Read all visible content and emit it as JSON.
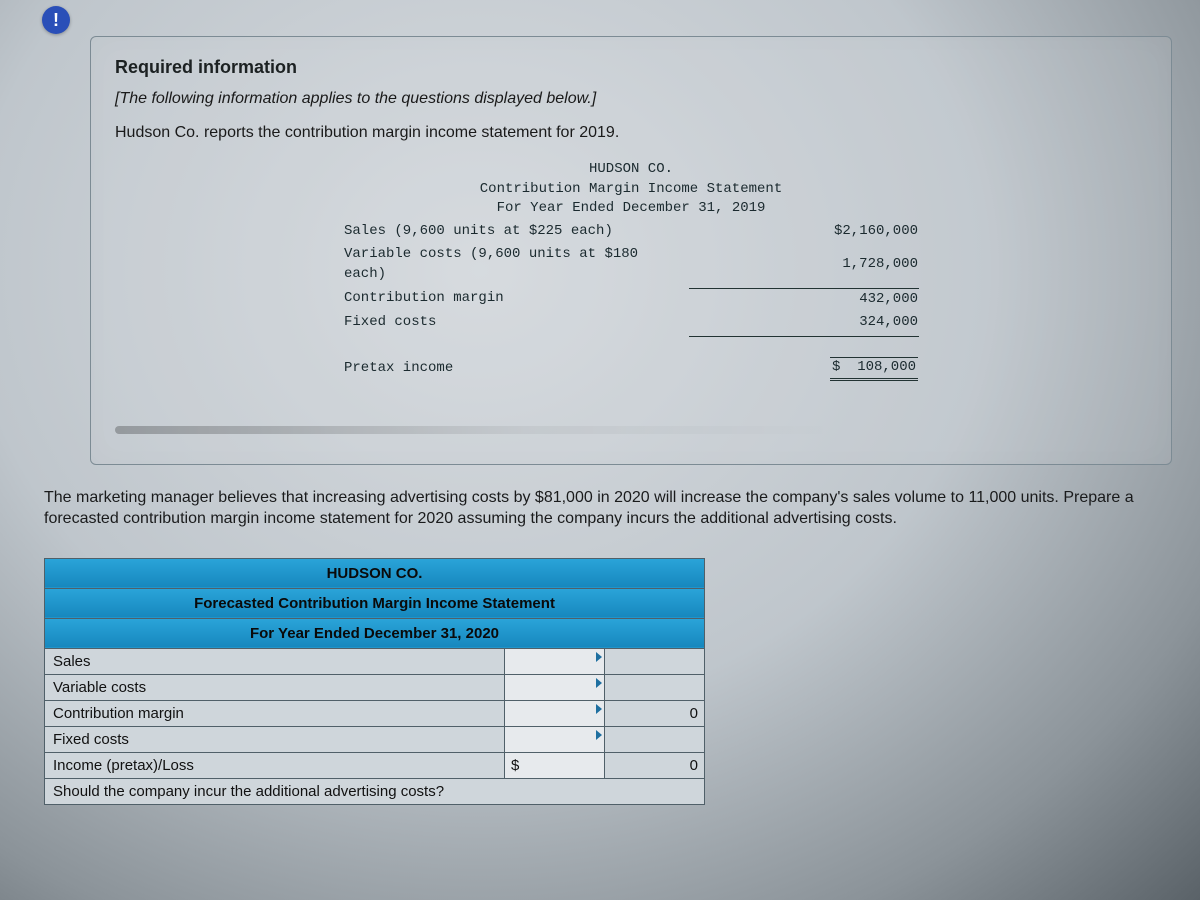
{
  "alert_glyph": "!",
  "info": {
    "required_heading": "Required information",
    "intro_italic": "[The following information applies to the questions displayed below.]",
    "intro_plain": "Hudson Co. reports the contribution margin income statement for 2019.",
    "statement": {
      "company": "HUDSON CO.",
      "title": "Contribution Margin Income Statement",
      "period": "For Year Ended December 31, 2019",
      "lines": {
        "sales_label": "Sales (9,600 units at $225 each)",
        "sales_amount": "$2,160,000",
        "var_label": "Variable costs (9,600 units at $180 each)",
        "var_amount": "1,728,000",
        "cm_label": "Contribution margin",
        "cm_amount": "432,000",
        "fixed_label": "Fixed costs",
        "fixed_amount": "324,000",
        "pretax_label": "Pretax income",
        "pretax_amount": "$  108,000"
      }
    }
  },
  "question": "The marketing manager believes that increasing advertising costs by $81,000 in 2020 will increase the company's sales volume to 11,000 units. Prepare a forecasted contribution margin income statement for 2020 assuming the company incurs the additional advertising costs.",
  "worksheet": {
    "header_company": "HUDSON CO.",
    "header_title": "Forecasted Contribution Margin Income Statement",
    "header_period": "For Year Ended December 31, 2020",
    "rows": {
      "sales": "Sales",
      "variable": "Variable costs",
      "cm": "Contribution margin",
      "fixed": "Fixed costs",
      "income": "Income (pretax)/Loss",
      "question": "Should the company incur the additional advertising costs?"
    },
    "values": {
      "cm_total": "0",
      "income_currency": "$",
      "income_total": "0"
    }
  }
}
